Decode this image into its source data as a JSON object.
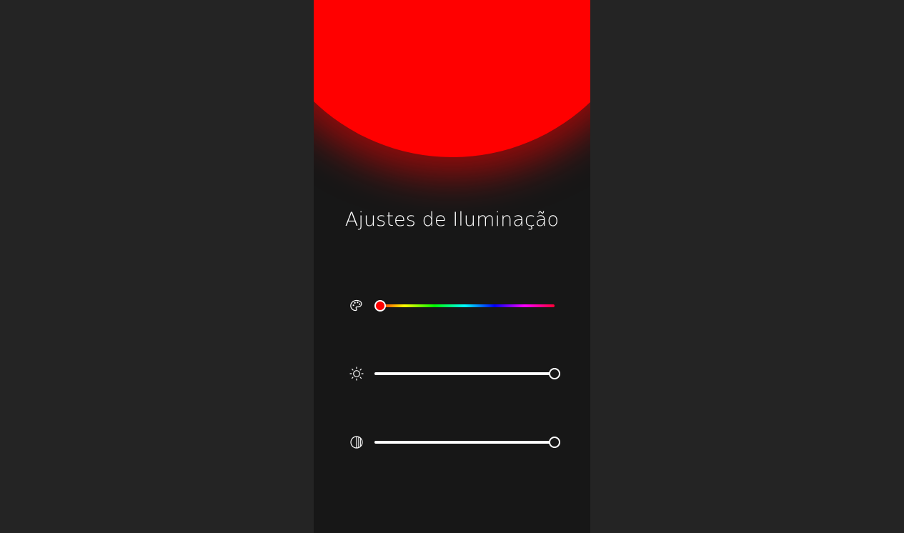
{
  "accent_color": "#ff0000",
  "background_color": "#242424",
  "panel_color": "#171717",
  "title": "Ajustes de Iluminação",
  "controls": [
    {
      "name": "color",
      "icon": "palette-icon",
      "value_fraction": 0.03
    },
    {
      "name": "brightness",
      "icon": "sun-icon",
      "value_fraction": 1.0
    },
    {
      "name": "contrast",
      "icon": "contrast-icon",
      "value_fraction": 1.0
    }
  ]
}
